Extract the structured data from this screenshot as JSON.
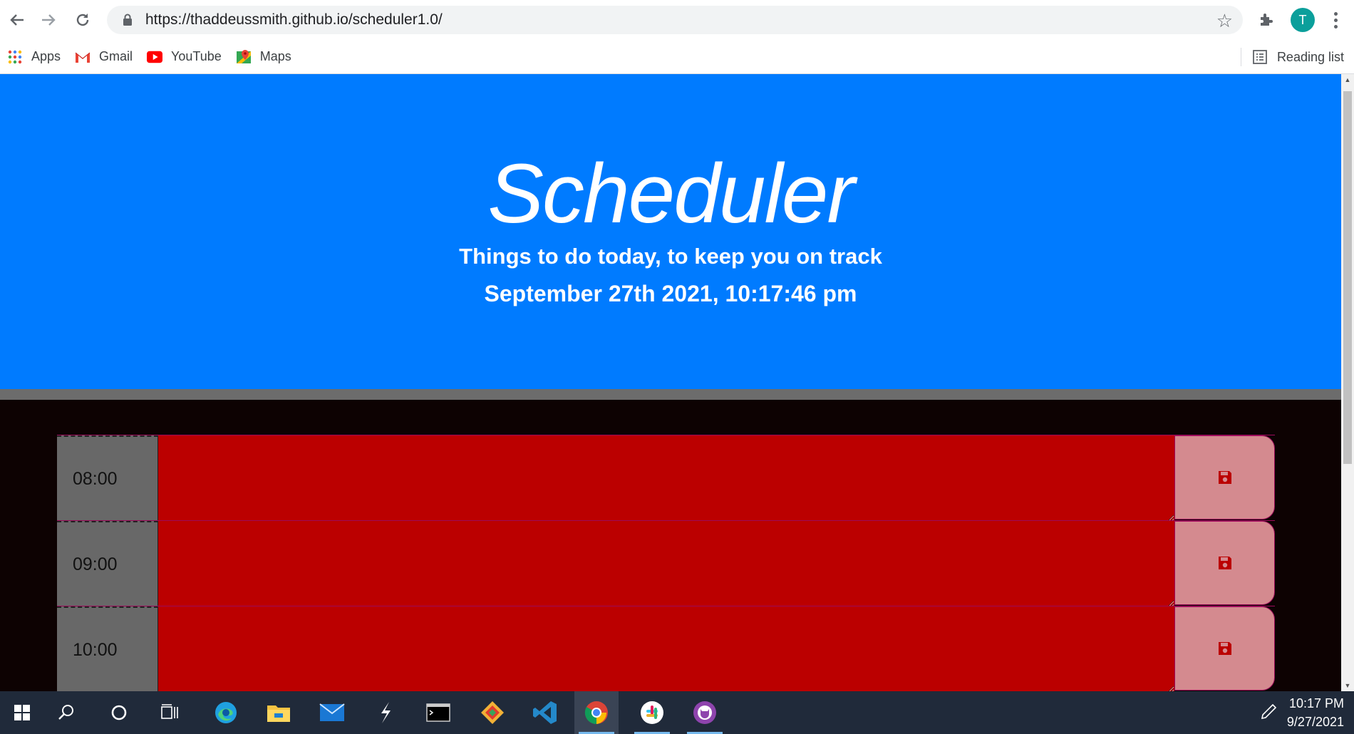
{
  "browser": {
    "url": "https://thaddeussmith.github.io/scheduler1.0/",
    "profile_initial": "T",
    "bookmarks": [
      {
        "label": "Apps",
        "icon": "apps-grid-icon"
      },
      {
        "label": "Gmail",
        "icon": "gmail-icon"
      },
      {
        "label": "YouTube",
        "icon": "youtube-icon"
      },
      {
        "label": "Maps",
        "icon": "maps-icon"
      }
    ],
    "reading_list_label": "Reading list"
  },
  "page": {
    "title": "Scheduler",
    "subtitle": "Things to do today, to keep you on track",
    "datetime": "September 27th 2021, 10:17:46 pm",
    "rows": [
      {
        "hour": "08:00",
        "text": "",
        "state": "past"
      },
      {
        "hour": "09:00",
        "text": "",
        "state": "past"
      },
      {
        "hour": "10:00",
        "text": "",
        "state": "past"
      }
    ],
    "colors": {
      "header": "#007bff",
      "past_row": "#bb0000",
      "save_button": "#d48a8f",
      "hour_cell": "#686868"
    }
  },
  "taskbar": {
    "apps": [
      "start",
      "search",
      "cortana",
      "task-view",
      "edge",
      "file-explorer",
      "mail",
      "app-s",
      "terminal",
      "git",
      "vscode",
      "chrome",
      "slack",
      "github-desktop"
    ],
    "time": "10:17 PM",
    "date": "9/27/2021"
  }
}
